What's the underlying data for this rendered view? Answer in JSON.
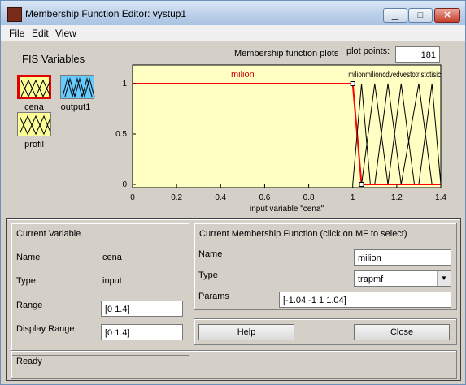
{
  "window": {
    "title": "Membership Function Editor: vystup1"
  },
  "menu": [
    "File",
    "Edit",
    "View"
  ],
  "fis_variables": {
    "heading": "FIS Variables",
    "items": [
      {
        "label": "cena",
        "selected": true,
        "color": "#ffff99"
      },
      {
        "label": "output1",
        "selected": false,
        "color": "#66ccff"
      },
      {
        "label": "profil",
        "selected": false,
        "color": "#ffff99"
      }
    ]
  },
  "plot": {
    "title": "Membership function plots",
    "plot_points_label": "plot points:",
    "plot_points_value": "181",
    "xlabel": "input variable \"cena\"",
    "xticks": [
      "0",
      "0.2",
      "0.4",
      "0.6",
      "0.8",
      "1",
      "1.2",
      "1.4"
    ],
    "yticks": [
      "1",
      "0.5",
      "0"
    ],
    "selected_mf_label": "milion",
    "mf_labels_top": "milionmilioncdvedvestotristotisic"
  },
  "chart_data": {
    "type": "line",
    "xlim": [
      0,
      1.4
    ],
    "ylim": [
      0,
      1
    ],
    "series": [
      {
        "name": "milion",
        "x": [
          0,
          1,
          1.04,
          1.4
        ],
        "y": [
          1,
          1,
          0,
          0
        ],
        "color": "#ff0000"
      },
      {
        "x": [
          1,
          1.04,
          1.08
        ],
        "y": [
          0,
          1,
          0
        ],
        "color": "#000000"
      },
      {
        "x": [
          1.04,
          1.1,
          1.16
        ],
        "y": [
          0,
          1,
          0
        ],
        "color": "#000000"
      },
      {
        "x": [
          1.1,
          1.16,
          1.22
        ],
        "y": [
          0,
          1,
          0
        ],
        "color": "#000000"
      },
      {
        "x": [
          1.16,
          1.22,
          1.28
        ],
        "y": [
          0,
          1,
          0
        ],
        "color": "#000000"
      },
      {
        "x": [
          1.22,
          1.3,
          1.36
        ],
        "y": [
          0,
          1,
          0
        ],
        "color": "#000000"
      },
      {
        "x": [
          1.3,
          1.36,
          1.4
        ],
        "y": [
          0,
          1,
          0
        ],
        "color": "#000000"
      }
    ]
  },
  "current_variable": {
    "heading": "Current Variable",
    "name_label": "Name",
    "name_value": "cena",
    "type_label": "Type",
    "type_value": "input",
    "range_label": "Range",
    "range_value": "[0 1.4]",
    "display_range_label": "Display Range",
    "display_range_value": "[0 1.4]"
  },
  "current_mf": {
    "heading": "Current Membership Function (click on MF to select)",
    "name_label": "Name",
    "name_value": "milion",
    "type_label": "Type",
    "type_value": "trapmf",
    "params_label": "Params",
    "params_value": "[-1.04 -1 1 1.04]"
  },
  "buttons": {
    "help": "Help",
    "close": "Close"
  },
  "status": "Ready"
}
